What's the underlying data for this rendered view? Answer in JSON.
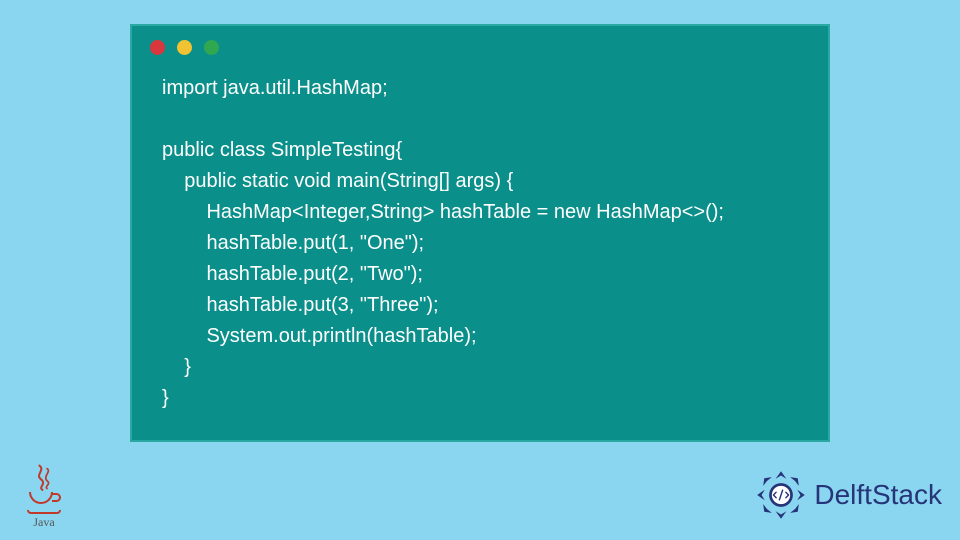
{
  "code": {
    "lines": [
      "import java.util.HashMap;",
      "",
      "public class SimpleTesting{",
      "    public static void main(String[] args) {",
      "        HashMap<Integer,String> hashTable = new HashMap<>();",
      "        hashTable.put(1, \"One\");",
      "        hashTable.put(2, \"Two\");",
      "        hashTable.put(3, \"Three\");",
      "        System.out.println(hashTable);",
      "    }",
      "}"
    ]
  },
  "branding": {
    "java_label": "Java",
    "delft_label": "DelftStack"
  },
  "colors": {
    "page_bg": "#8ad5f0",
    "window_bg": "#0b8f8a",
    "window_border": "#2aa9a3",
    "dot_red": "#d9363e",
    "dot_yellow": "#f1c232",
    "dot_green": "#2fa84f",
    "code_text": "#ffffff",
    "brand_text": "#263478",
    "java_red": "#c0392b"
  }
}
